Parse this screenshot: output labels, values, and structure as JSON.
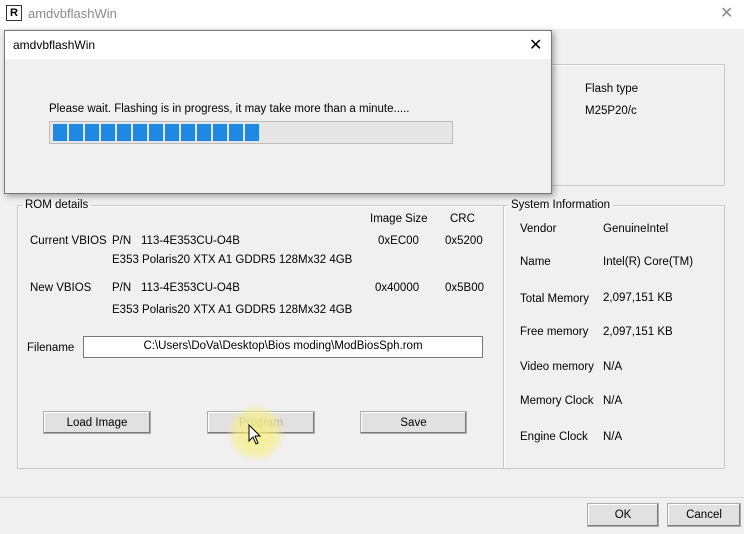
{
  "main_window": {
    "title": "amdvbflashWin",
    "icon_letter": "R"
  },
  "flash_info": {
    "flash_type_label": "Flash type",
    "flash_type_value": "M25P20/c"
  },
  "rom_details": {
    "legend": "ROM details",
    "col_image_size": "Image Size",
    "col_crc": "CRC",
    "current": {
      "label": "Current VBIOS",
      "pn_label": "P/N",
      "pn": "113-4E353CU-O4B",
      "desc": "E353 Polaris20 XTX A1 GDDR5 128Mx32 4GB",
      "image_size": "0xEC00",
      "crc": "0x5200"
    },
    "new": {
      "label": "New VBIOS",
      "pn_label": "P/N",
      "pn": "113-4E353CU-O4B",
      "desc": "E353 Polaris20 XTX A1 GDDR5 128Mx32 4GB",
      "image_size": "0x40000",
      "crc": "0x5B00"
    },
    "filename_label": "Filename",
    "filename_value": "C:\\Users\\DoVa\\Desktop\\Bios moding\\ModBiosSph.rom",
    "load_image_label": "Load Image",
    "program_label": "Program",
    "save_label": "Save"
  },
  "system_info": {
    "legend": "System Information",
    "rows": [
      {
        "label": "Vendor",
        "value": "GenuineIntel"
      },
      {
        "label": "Name",
        "value": "Intel(R) Core(TM)"
      },
      {
        "label": "Total Memory",
        "value": "2,097,151 KB"
      },
      {
        "label": "Free memory",
        "value": "2,097,151 KB"
      },
      {
        "label": "Video memory",
        "value": "N/A"
      },
      {
        "label": "Memory Clock",
        "value": "N/A"
      },
      {
        "label": "Engine Clock",
        "value": "N/A"
      }
    ]
  },
  "bottom": {
    "ok_label": "OK",
    "cancel_label": "Cancel"
  },
  "dialog": {
    "title": "amdvbflashWin",
    "message": "Please wait.  Flashing is in progress, it may take more than a minute.....",
    "progress": 0.52,
    "segments_filled": 13
  },
  "colors": {
    "progress": "#1e88e5",
    "cursor_highlight": "#faf078"
  }
}
